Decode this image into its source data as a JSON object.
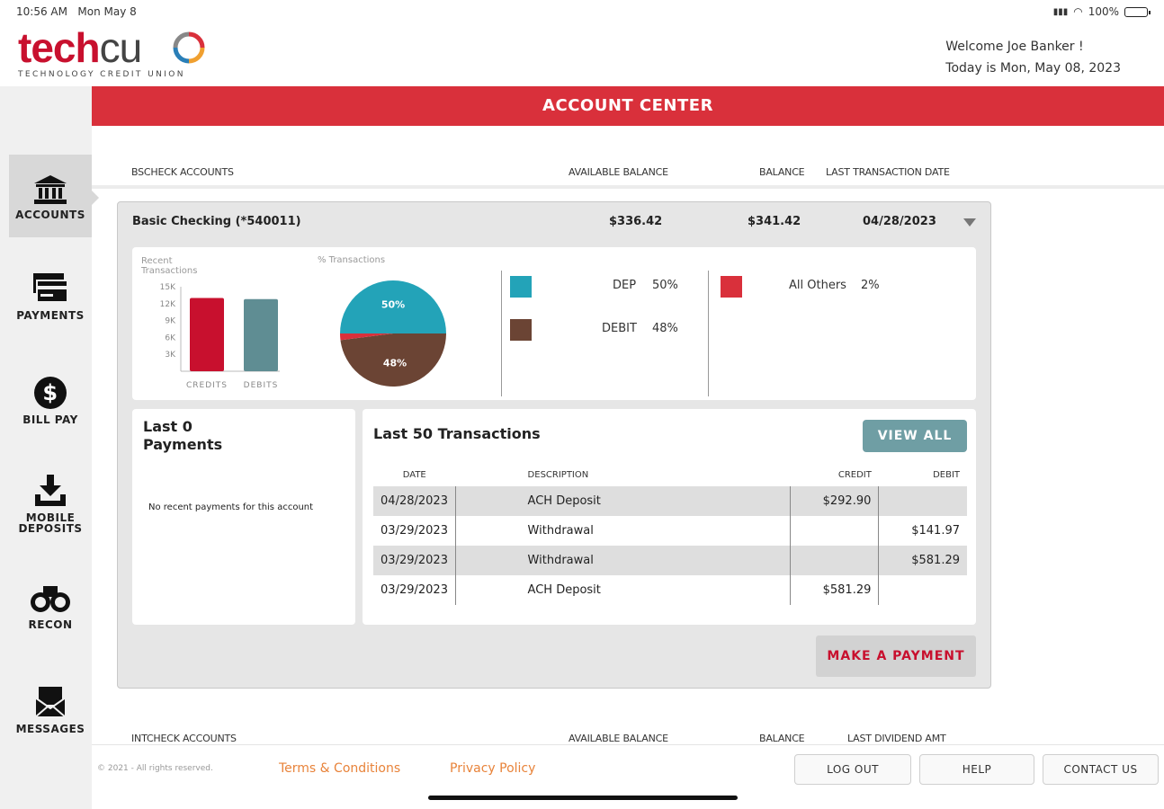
{
  "status": {
    "time": "10:56 AM",
    "date": "Mon May 8",
    "battery": "100%"
  },
  "logo": {
    "tech": "tech",
    "cu": "cu",
    "tagline": "TECHNOLOGY CREDIT UNION"
  },
  "welcome": {
    "line1": "Welcome Joe Banker !",
    "line2": "Today is Mon, May 08, 2023"
  },
  "banner": {
    "title": "ACCOUNT CENTER"
  },
  "sidebar": {
    "items": [
      {
        "label": "ACCOUNTS",
        "icon": "bank-icon",
        "active": true
      },
      {
        "label": "PAYMENTS",
        "icon": "card-icon"
      },
      {
        "label": "BILL PAY",
        "icon": "dollar-circle-icon"
      },
      {
        "label": "MOBILE",
        "label2": "DEPOSITS",
        "icon": "download-tray-icon"
      },
      {
        "label": "RECON",
        "icon": "binoculars-icon"
      },
      {
        "label": "MESSAGES",
        "icon": "envelope-icon"
      }
    ]
  },
  "section1": {
    "name": "BSCHECK ACCOUNTS",
    "col_available": "AVAILABLE BALANCE",
    "col_balance": "BALANCE",
    "col_last": "LAST TRANSACTION DATE"
  },
  "account": {
    "name": "Basic Checking (*540011)",
    "available": "$336.42",
    "balance": "$341.42",
    "last_date": "04/28/2023"
  },
  "summary": {
    "recent_label1": "Recent",
    "recent_label2": "Transactions",
    "pct_label": "% Transactions",
    "bar_chart": {
      "categories": [
        "CREDITS",
        "DEBITS"
      ],
      "values": [
        13000,
        12800
      ],
      "yticks": [
        "15K",
        "12K",
        "9K",
        "6K",
        "3K"
      ],
      "ylim": [
        0,
        15000
      ],
      "colors": [
        "#c8102e",
        "#5f8d93"
      ]
    },
    "pie": {
      "slices": [
        {
          "name": "DEP",
          "value": 50,
          "label": "50%",
          "color": "#23a3b8"
        },
        {
          "name": "DEBIT",
          "value": 48,
          "label": "48%",
          "color": "#6b4434"
        },
        {
          "name": "All Others",
          "value": 2,
          "color": "#d9303b"
        }
      ]
    },
    "legend": [
      {
        "name": "DEP",
        "pct": "50%",
        "color": "#23a3b8"
      },
      {
        "name": "DEBIT",
        "pct": "48%",
        "color": "#6b4434"
      },
      {
        "name": "All Others",
        "pct": "2%",
        "color": "#d9303b"
      }
    ]
  },
  "payments": {
    "title1": "Last 0",
    "title2": "Payments",
    "empty": "No recent payments for this account"
  },
  "transactions": {
    "title": "Last 50 Transactions",
    "view_all": "VIEW ALL",
    "headers": {
      "date": "DATE",
      "description": "DESCRIPTION",
      "credit": "CREDIT",
      "debit": "DEBIT"
    },
    "rows": [
      {
        "date": "04/28/2023",
        "description": "ACH Deposit",
        "credit": "$292.90",
        "debit": ""
      },
      {
        "date": "03/29/2023",
        "description": "Withdrawal",
        "credit": "",
        "debit": "$141.97"
      },
      {
        "date": "03/29/2023",
        "description": "Withdrawal",
        "credit": "",
        "debit": "$581.29"
      },
      {
        "date": "03/29/2023",
        "description": "ACH Deposit",
        "credit": "$581.29",
        "debit": ""
      }
    ]
  },
  "make_payment": "MAKE A PAYMENT",
  "section2": {
    "name": "INTCHECK ACCOUNTS",
    "col_available": "AVAILABLE BALANCE",
    "col_balance": "BALANCE",
    "col_last": "LAST DIVIDEND AMT"
  },
  "footer": {
    "copyright": "© 2021 - All rights reserved.",
    "terms": "Terms & Conditions",
    "privacy": "Privacy Policy",
    "logout": "LOG OUT",
    "help": "HELP",
    "contact": "CONTACT US"
  }
}
